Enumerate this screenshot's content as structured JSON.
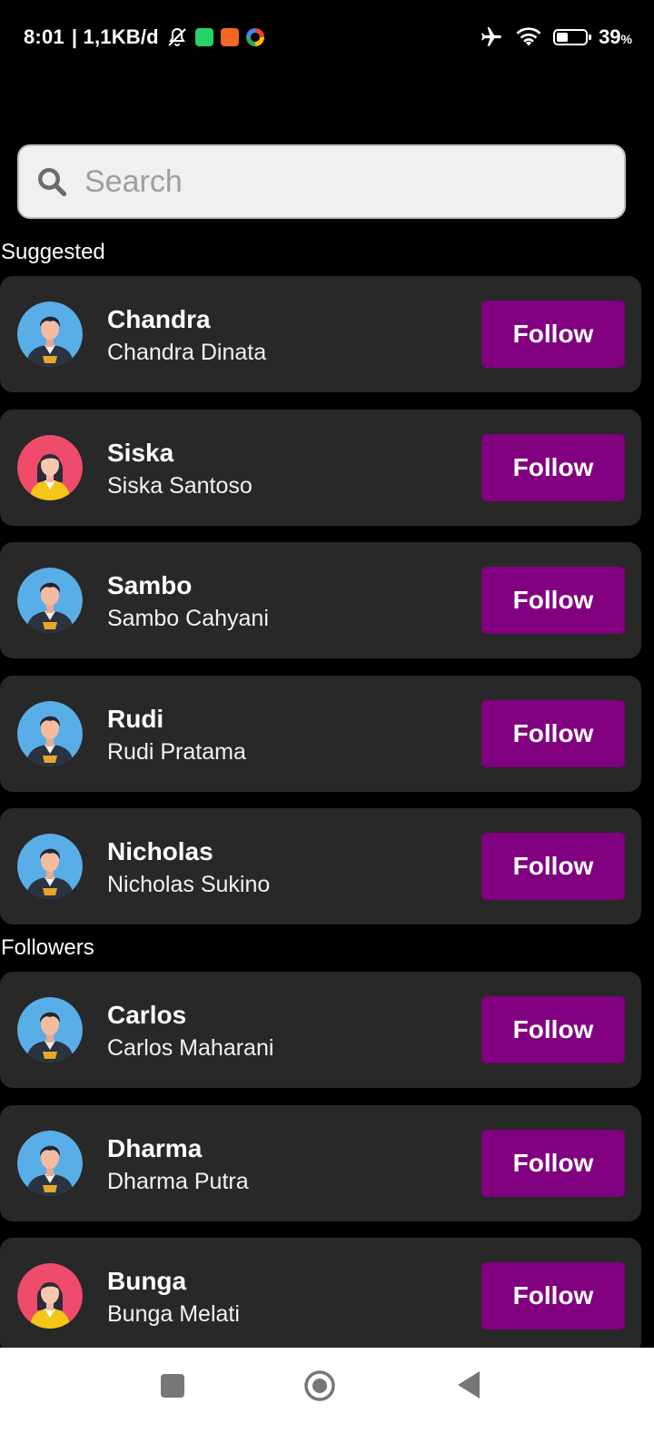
{
  "status_bar": {
    "time": "8:01",
    "net_speed": "| 1,1KB/d",
    "battery_percent": "39",
    "battery_unit": "%",
    "battery_level": 0.39,
    "left_icons": [
      "bell-off-icon",
      "whatsapp-icon",
      "shopping-bag-icon",
      "google-icon"
    ],
    "right_icons": [
      "airplane-icon",
      "wifi-icon",
      "battery-icon"
    ]
  },
  "search": {
    "placeholder": "Search",
    "value": ""
  },
  "sections": {
    "suggested_label": "Suggested",
    "followers_label": "Followers"
  },
  "suggested": [
    {
      "username": "Chandra",
      "fullname": "Chandra Dinata",
      "avatar": "male",
      "button": "Follow"
    },
    {
      "username": "Siska",
      "fullname": "Siska Santoso",
      "avatar": "female",
      "button": "Follow"
    },
    {
      "username": "Sambo",
      "fullname": "Sambo Cahyani",
      "avatar": "male",
      "button": "Follow"
    },
    {
      "username": "Rudi",
      "fullname": "Rudi Pratama",
      "avatar": "male",
      "button": "Follow"
    },
    {
      "username": "Nicholas",
      "fullname": "Nicholas Sukino",
      "avatar": "male",
      "button": "Follow"
    }
  ],
  "followers": [
    {
      "username": "Carlos",
      "fullname": "Carlos Maharani",
      "avatar": "male",
      "button": "Follow"
    },
    {
      "username": "Dharma",
      "fullname": "Dharma Putra",
      "avatar": "male",
      "button": "Follow"
    },
    {
      "username": "Bunga",
      "fullname": "Bunga Melati",
      "avatar": "female",
      "button": "Follow"
    }
  ],
  "colors": {
    "background": "#000000",
    "card": "#282828",
    "follow_button": "#800080",
    "male_avatar_bg": "#5aaee8",
    "female_avatar_bg": "#ef4b6b"
  },
  "nav_bar": {
    "icons": [
      "recents-square-icon",
      "home-circle-icon",
      "back-triangle-icon"
    ]
  }
}
